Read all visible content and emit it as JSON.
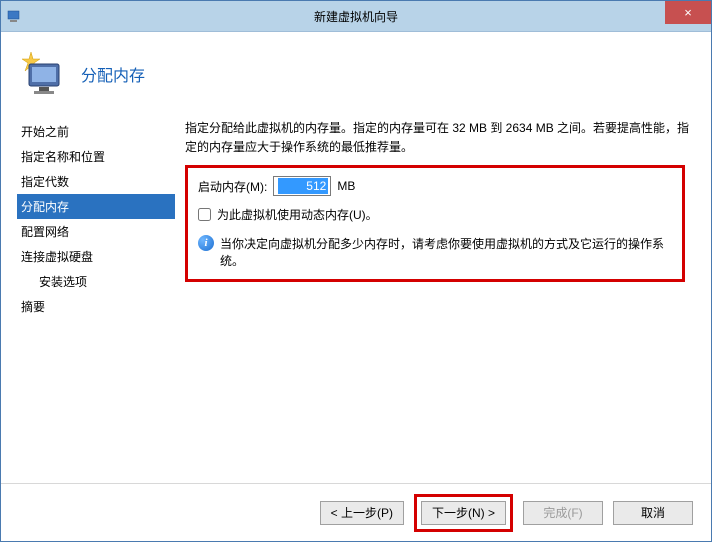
{
  "window": {
    "title": "新建虚拟机向导",
    "close": "×"
  },
  "header": {
    "title": "分配内存"
  },
  "sidebar": {
    "items": [
      {
        "label": "开始之前",
        "active": false
      },
      {
        "label": "指定名称和位置",
        "active": false
      },
      {
        "label": "指定代数",
        "active": false
      },
      {
        "label": "分配内存",
        "active": true
      },
      {
        "label": "配置网络",
        "active": false
      },
      {
        "label": "连接虚拟硬盘",
        "active": false
      },
      {
        "label": "安装选项",
        "active": false,
        "sub": true
      },
      {
        "label": "摘要",
        "active": false
      }
    ]
  },
  "content": {
    "description": "指定分配给此虚拟机的内存量。指定的内存量可在 32 MB 到 2634 MB 之间。若要提高性能，指定的内存量应大于操作系统的最低推荐量。",
    "memory_label": "启动内存(M):",
    "memory_value": "512",
    "memory_unit": "MB",
    "dynamic_checkbox_label": "为此虚拟机使用动态内存(U)。",
    "info_text": "当你决定向虚拟机分配多少内存时，请考虑你要使用虚拟机的方式及它运行的操作系统。"
  },
  "footer": {
    "prev": "< 上一步(P)",
    "next": "下一步(N) >",
    "finish": "完成(F)",
    "cancel": "取消"
  }
}
